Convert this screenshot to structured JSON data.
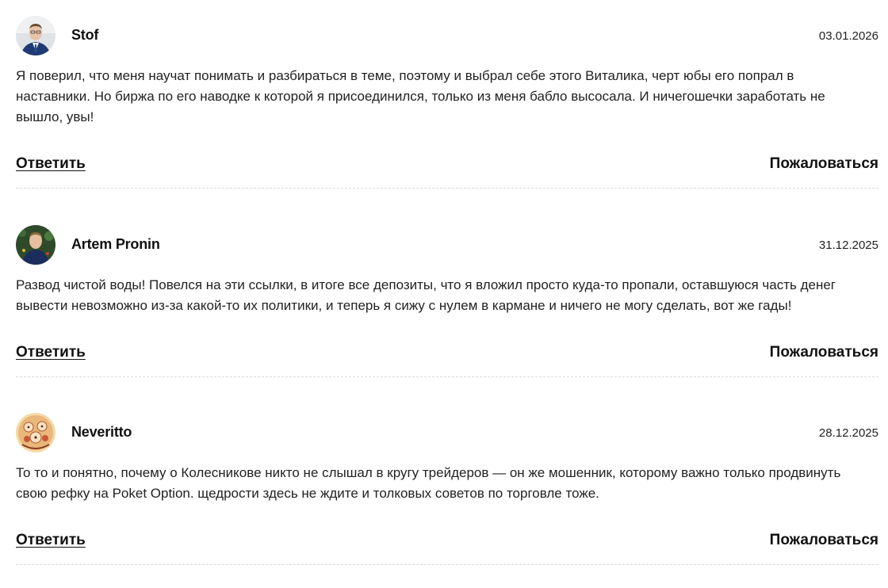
{
  "comments": [
    {
      "author": "Stof",
      "date": "03.01.2026",
      "text": "Я поверил, что меня научат понимать и разбираться в теме, поэтому и выбрал себе этого Виталика, черт юбы его попрал в наставники. Но биржа по его наводке к которой я присоединился, только из меня бабло высосала. И ничегошечки заработать не вышло, увы!",
      "reply_label": "Ответить",
      "report_label": "Пожаловаться"
    },
    {
      "author": "Artem Pronin",
      "date": "31.12.2025",
      "text": "Развод чистой воды! Повелся на эти ссылки, в итоге все депозиты, что я вложил просто куда-то пропали, оставшуюся часть денег вывести невозможно из-за какой-то их политики, и теперь я сижу с нулем в кармане и ничего не могу сделать, вот же гады!",
      "reply_label": "Ответить",
      "report_label": "Пожаловаться"
    },
    {
      "author": "Neveritto",
      "date": "28.12.2025",
      "text": "То то и понятно, почему о Колесникове никто не слышал в кругу трейдеров — он же мошенник, которому важно только продвинуть свою рефку на Poket Option. щедрости здесь не ждите и толковых советов по торговле тоже.",
      "reply_label": "Ответить",
      "report_label": "Пожаловаться"
    }
  ],
  "colors": {
    "text": "#222222",
    "divider": "#dcdcdc",
    "background": "#ffffff"
  }
}
